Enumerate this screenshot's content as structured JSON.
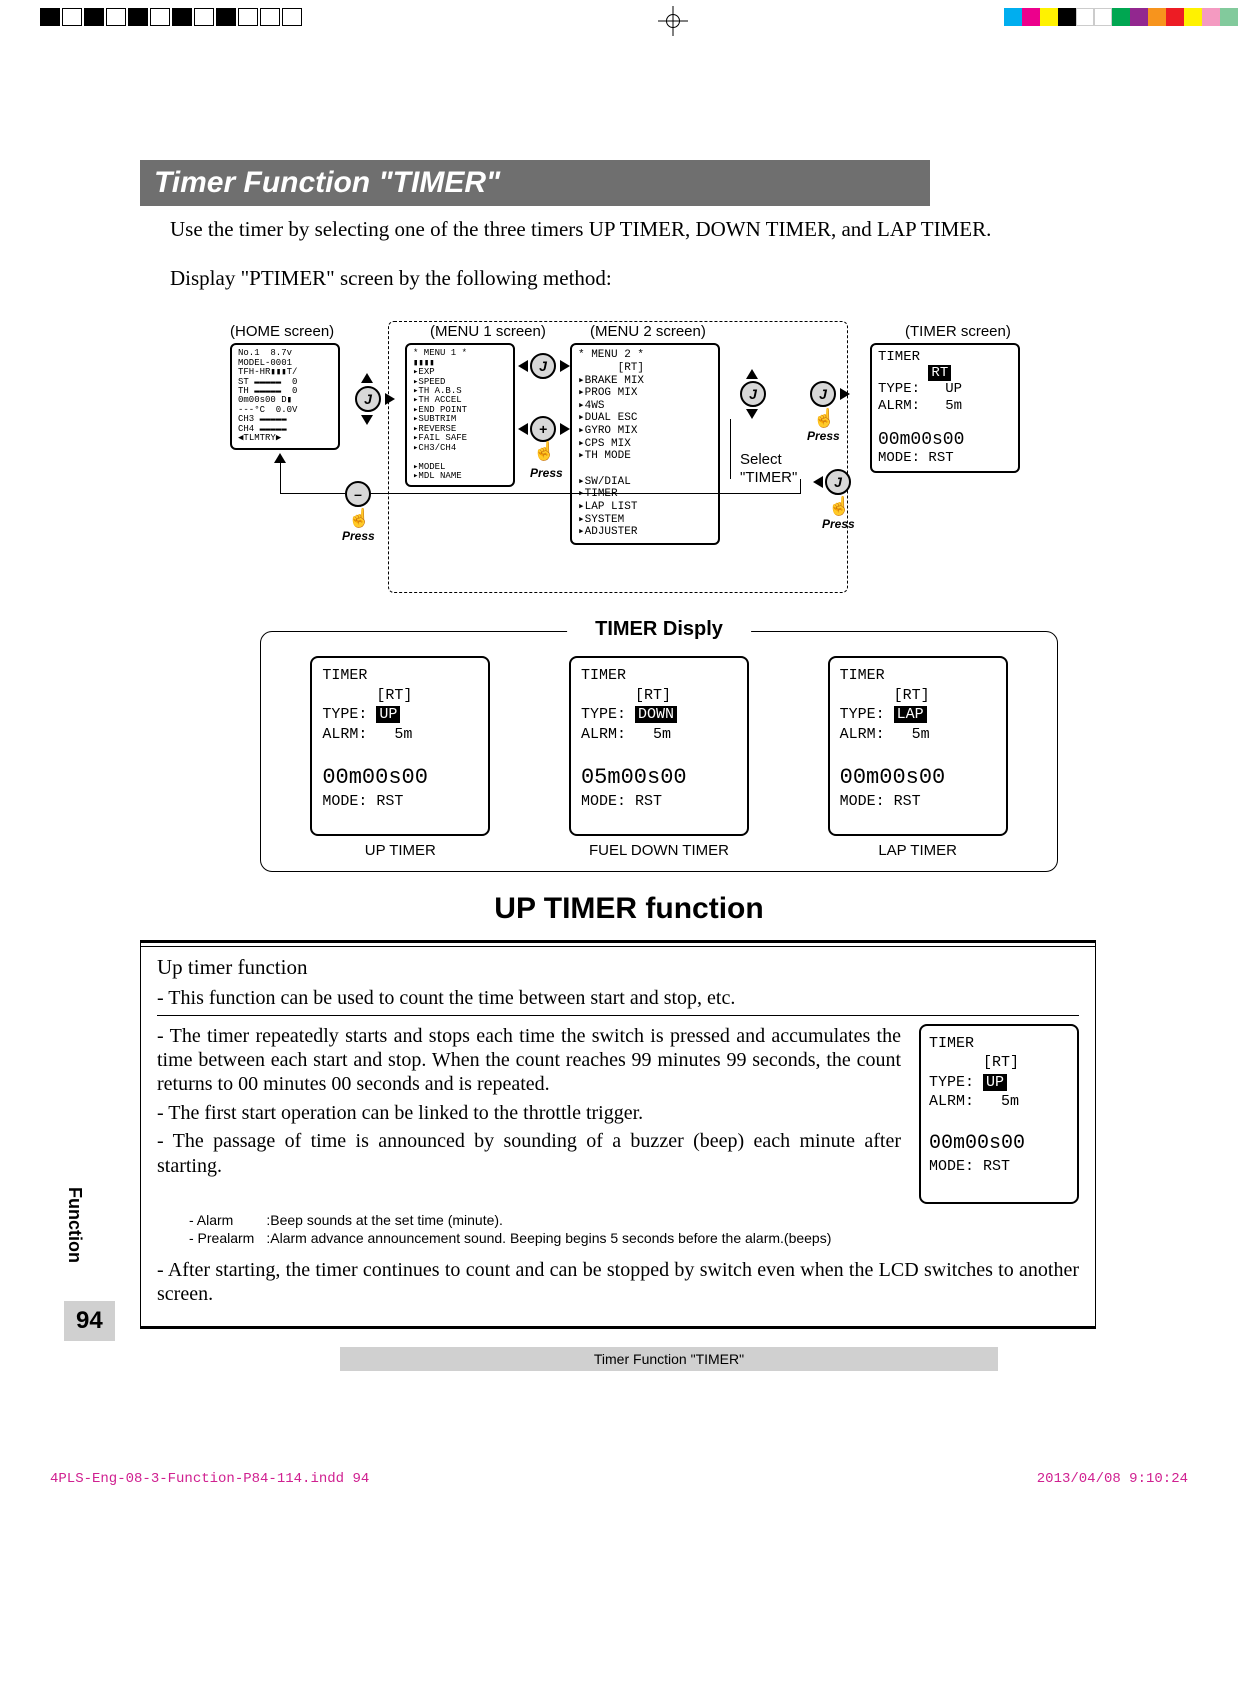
{
  "print_marks": {
    "colors": [
      "#00aeef",
      "#ec008c",
      "#fff200",
      "#000000",
      "#ffffff",
      "#ffffff",
      "#00a651",
      "#92278f",
      "#f7941d",
      "#ed1c24",
      "#fff200",
      "#f49ac1",
      "#82ca9c"
    ]
  },
  "header": {
    "title": "Timer Function  \"TIMER\""
  },
  "intro": {
    "p1": "Use the timer by selecting one of the three timers UP TIMER, DOWN TIMER, and LAP TIMER.",
    "p2": "Display \"PTIMER\" screen by the following method:"
  },
  "flow": {
    "labels": {
      "home": "(HOME screen)",
      "menu1": "(MENU 1 screen)",
      "menu2": "(MENU 2 screen)",
      "timer": "(TIMER screen)",
      "select": "Select",
      "select2": "\"TIMER\""
    },
    "buttons": {
      "j": "J",
      "plus": "+",
      "minus": "–"
    },
    "press": "Press",
    "home_screen": "No.1  8.7v\nMODEL-0001\nTFH-HR▮▮▮T/\nST ▬▬▬▬▬  0\nTH ▬▬▬▬▬  0\n0m00s00 D▮\n---°C  0.0V\nCH3 ▬▬▬▬▬\nCH4 ▬▬▬▬▬\n◀TLMTRY▶",
    "menu1_screen": "* MENU 1 *\n▮▮▮▮\n▸EXP\n▸SPEED\n▸TH A.B.S\n▸TH ACCEL\n▸END POINT\n▸SUBTRIM\n▸REVERSE\n▸FAIL SAFE\n▸CH3/CH4\n\n▸MODEL\n▸MDL NAME",
    "menu2_screen": "* MENU 2 *\n      [RT]\n▸BRAKE MIX\n▸PROG MIX\n▸4WS\n▸DUAL ESC\n▸GYRO MIX\n▸CPS MIX\n▸TH MODE\n\n▸SW/DIAL\n▸TIMER\n▸LAP LIST\n▸SYSTEM\n▸ADJUSTER",
    "timer_screen_header": "TIMER",
    "timer_screen_rt": "RT",
    "timer_screen": {
      "type_label": "TYPE:",
      "type_val": "UP",
      "alrm_label": "ALRM:",
      "alrm_val": "5m",
      "time": "00m00s00",
      "mode_label": "MODE:",
      "mode_val": "RST"
    }
  },
  "timer_display": {
    "title": "TIMER Disply",
    "columns": [
      {
        "caption": "UP TIMER",
        "header": "TIMER",
        "rt": "[RT]",
        "type_label": "TYPE:",
        "type_val": "UP",
        "type_inv": true,
        "alrm_label": "ALRM:",
        "alrm_val": "5m",
        "time": "00m00s00",
        "mode_label": "MODE:",
        "mode_val": "RST"
      },
      {
        "caption": "FUEL DOWN  TIMER",
        "header": "TIMER",
        "rt": "[RT]",
        "type_label": "TYPE:",
        "type_val": "DOWN",
        "type_inv": true,
        "alrm_label": "ALRM:",
        "alrm_val": "5m",
        "time": "05m00s00",
        "mode_label": "MODE:",
        "mode_val": "RST"
      },
      {
        "caption": "LAP TIMER",
        "header": "TIMER",
        "rt": "[RT]",
        "type_label": "TYPE:",
        "type_val": "LAP",
        "type_inv": true,
        "alrm_label": "ALRM:",
        "alrm_val": "5m",
        "time": "00m00s00",
        "mode_label": "MODE:",
        "mode_val": "RST"
      }
    ]
  },
  "up_timer": {
    "heading": "UP TIMER function",
    "box_title": "Up timer function",
    "p1": "- This function can be used to count the time between start and stop, etc.",
    "p2": "- The timer repeatedly starts and stops each time the switch is pressed and accumulates the time between each start and stop. When the count reaches 99 minutes 99 seconds, the count returns to 00 minutes 00 seconds and is repeated.",
    "p3": "- The first start operation can be linked to the throttle trigger.",
    "p4": "- The passage of time is announced by sounding of a buzzer (beep) each minute after starting.",
    "note_alarm_label": "- Alarm",
    "note_alarm": ":Beep sounds at the set time (minute).",
    "note_prealarm_label": "- Prealarm",
    "note_prealarm": ":Alarm advance announcement sound. Beeping begins 5 seconds before the alarm.(beeps)",
    "p5": "- After starting, the timer continues to count and can be stopped by switch even when the LCD switches to another screen.",
    "side_lcd": {
      "header": "TIMER",
      "rt": "[RT]",
      "type_label": "TYPE:",
      "type_val": "UP",
      "alrm_label": "ALRM:",
      "alrm_val": "5m",
      "time": "00m00s00",
      "mode_label": "MODE:",
      "mode_val": "RST"
    }
  },
  "footer": {
    "page_num": "94",
    "side_tab": "Function",
    "bar": "Timer Function  \"TIMER\"",
    "file": "4PLS-Eng-08-3-Function-P84-114.indd   94",
    "timestamp": "2013/04/08   9:10:24"
  }
}
